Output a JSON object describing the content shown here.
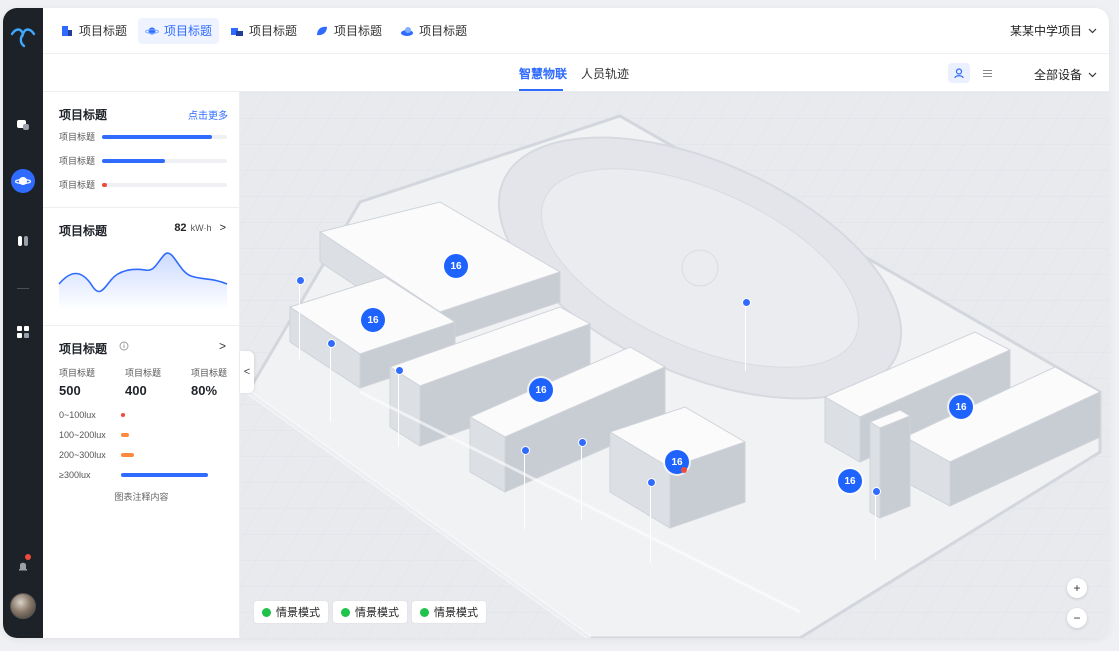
{
  "nav": {
    "items": [
      {
        "icon": "chat-icon"
      },
      {
        "icon": "planet-icon",
        "active": true
      },
      {
        "icon": "device-icon"
      },
      {
        "icon": "grid-icon"
      }
    ],
    "bottom": {
      "icon": "bell-icon",
      "has_notification": true
    }
  },
  "project_tabs": [
    {
      "label": "项目标题",
      "icon": "building-icon"
    },
    {
      "label": "项目标题",
      "icon": "planet-icon",
      "active": true
    },
    {
      "label": "项目标题",
      "icon": "campus-icon"
    },
    {
      "label": "项目标题",
      "icon": "leaf-icon"
    },
    {
      "label": "项目标题",
      "icon": "cloud-icon"
    }
  ],
  "project_select": {
    "value": "某某中学项目"
  },
  "sub_tabs": [
    {
      "label": "智慧物联",
      "active": true
    },
    {
      "label": "人员轨迹"
    }
  ],
  "device_select": {
    "value": "全部设备"
  },
  "panel": {
    "card1": {
      "title": "项目标题",
      "more": "点击更多",
      "bars": [
        {
          "label": "项目标题",
          "value": 0.88,
          "color": "#2f6bff"
        },
        {
          "label": "项目标题",
          "value": 0.5,
          "color": "#2f6bff"
        },
        {
          "label": "项目标题",
          "value": 0.04,
          "color": "#f04b3a"
        }
      ]
    },
    "card2": {
      "title": "项目标题",
      "value": "82",
      "unit": "kW·h",
      "arrow": ">"
    },
    "card3": {
      "title": "项目标题",
      "arrow": ">",
      "stats": [
        {
          "label": "项目标题",
          "value": "500"
        },
        {
          "label": "项目标题",
          "value": "400"
        },
        {
          "label": "项目标题",
          "value": "80%"
        }
      ],
      "lux": [
        {
          "label": "0~100lux",
          "value": 0.03,
          "color": "#f04b3a"
        },
        {
          "label": "100~200lux",
          "value": 0.07,
          "color": "#ff8a3d"
        },
        {
          "label": "200~300lux",
          "value": 0.11,
          "color": "#ff8a3d"
        },
        {
          "label": "≥300lux",
          "value": 0.74,
          "color": "#2f6bff"
        }
      ],
      "note": "图表注释内容"
    }
  },
  "map": {
    "markers": [
      "16",
      "16",
      "16",
      "16",
      "16",
      "16"
    ],
    "modes": [
      "情景模式",
      "情景模式",
      "情景模式"
    ],
    "zoom_in": "+",
    "zoom_out": "−",
    "collapse": "<"
  },
  "colors": {
    "accent": "#2f6bff",
    "nav_bg": "#1d2128",
    "mode_dot": "#1fc24a"
  }
}
